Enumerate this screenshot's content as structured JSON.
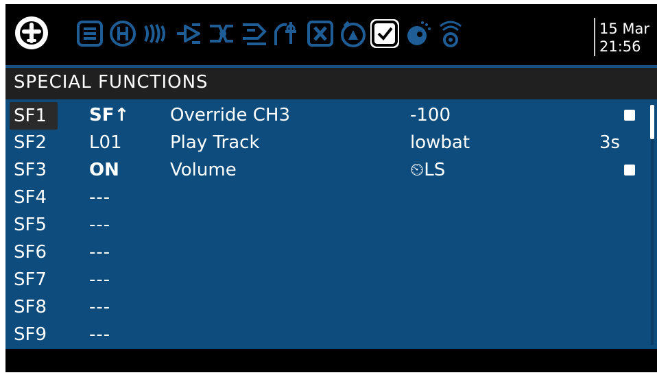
{
  "topbar": {
    "menu_icon": "airplane-icon",
    "tabs": [
      {
        "name": "tab-checklist",
        "icon": "list-icon"
      },
      {
        "name": "tab-heli",
        "icon": "helicopter-h-icon"
      },
      {
        "name": "tab-flight-modes",
        "icon": "flight-modes-icon"
      },
      {
        "name": "tab-inputs",
        "icon": "inputs-icon"
      },
      {
        "name": "tab-mixes",
        "icon": "mixer-icon"
      },
      {
        "name": "tab-outputs",
        "icon": "outputs-icon"
      },
      {
        "name": "tab-curves",
        "icon": "curves-icon"
      },
      {
        "name": "tab-gvars",
        "icon": "gvars-icon"
      },
      {
        "name": "tab-logical-switches",
        "icon": "logical-switches-icon"
      },
      {
        "name": "tab-special-functions",
        "icon": "special-functions-icon"
      },
      {
        "name": "tab-custom-scripts",
        "icon": "custom-scripts-icon"
      },
      {
        "name": "tab-telemetry",
        "icon": "telemetry-icon"
      }
    ],
    "date": "15 Mar",
    "time": "21:56"
  },
  "page": {
    "title": "SPECIAL FUNCTIONS"
  },
  "rows": [
    {
      "id": "SF1",
      "switch": "SF↑",
      "switch_bold": true,
      "function": "Override CH3",
      "param": "-100",
      "repeat": "",
      "checkbox": true,
      "selected": true
    },
    {
      "id": "SF2",
      "switch": "L01",
      "switch_bold": false,
      "function": "Play Track",
      "param": "lowbat",
      "repeat": "3s",
      "checkbox": false,
      "selected": false
    },
    {
      "id": "SF3",
      "switch": "ON",
      "switch_bold": true,
      "function": "Volume",
      "param": "⏲LS",
      "repeat": "",
      "checkbox": true,
      "selected": false
    },
    {
      "id": "SF4",
      "switch": "---",
      "switch_bold": false,
      "function": "",
      "param": "",
      "repeat": "",
      "checkbox": false,
      "selected": false
    },
    {
      "id": "SF5",
      "switch": "---",
      "switch_bold": false,
      "function": "",
      "param": "",
      "repeat": "",
      "checkbox": false,
      "selected": false
    },
    {
      "id": "SF6",
      "switch": "---",
      "switch_bold": false,
      "function": "",
      "param": "",
      "repeat": "",
      "checkbox": false,
      "selected": false
    },
    {
      "id": "SF7",
      "switch": "---",
      "switch_bold": false,
      "function": "",
      "param": "",
      "repeat": "",
      "checkbox": false,
      "selected": false
    },
    {
      "id": "SF8",
      "switch": "---",
      "switch_bold": false,
      "function": "",
      "param": "",
      "repeat": "",
      "checkbox": false,
      "selected": false
    },
    {
      "id": "SF9",
      "switch": "---",
      "switch_bold": false,
      "function": "",
      "param": "",
      "repeat": "",
      "checkbox": false,
      "selected": false
    }
  ],
  "colors": {
    "accent": "#0d4c7c",
    "topbar_icon": "#1e5d95",
    "title_bg": "#202020"
  }
}
